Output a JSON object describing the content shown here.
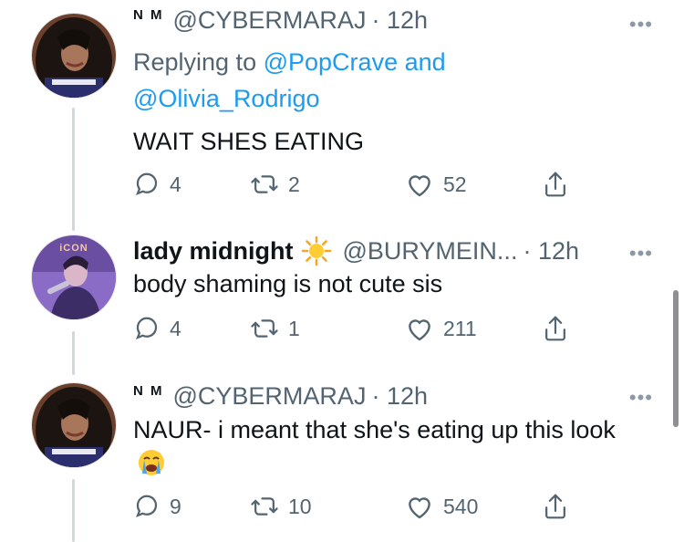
{
  "colors": {
    "link": "#1d9bf0",
    "secondary": "#536471",
    "text": "#0f1419"
  },
  "tweets": [
    {
      "prefix": "N M",
      "handle": "@CYBERMARAJ",
      "time": "· 12h",
      "more": "•••",
      "replying_label": "Replying to",
      "replying_to": [
        "@PopCrave",
        "@Olivia_Rodrigo"
      ],
      "replying_joiner": "and",
      "text": "WAIT SHES EATING",
      "replies": "4",
      "retweets": "2",
      "likes": "52"
    },
    {
      "display_name": "lady midnight",
      "emoji": "sun-emoji",
      "handle": "@BURYMEIN...",
      "time": "· 12h",
      "more": "•••",
      "avatar_caption": "iCON",
      "text": "body shaming is not cute sis",
      "replies": "4",
      "retweets": "1",
      "likes": "211"
    },
    {
      "prefix": "N M",
      "handle": "@CYBERMARAJ",
      "time": "· 12h",
      "more": "•••",
      "text": "NAUR- i meant that she's eating up this look",
      "emoji": "loudly-crying-face-emoji",
      "replies": "9",
      "retweets": "10",
      "likes": "540"
    }
  ]
}
